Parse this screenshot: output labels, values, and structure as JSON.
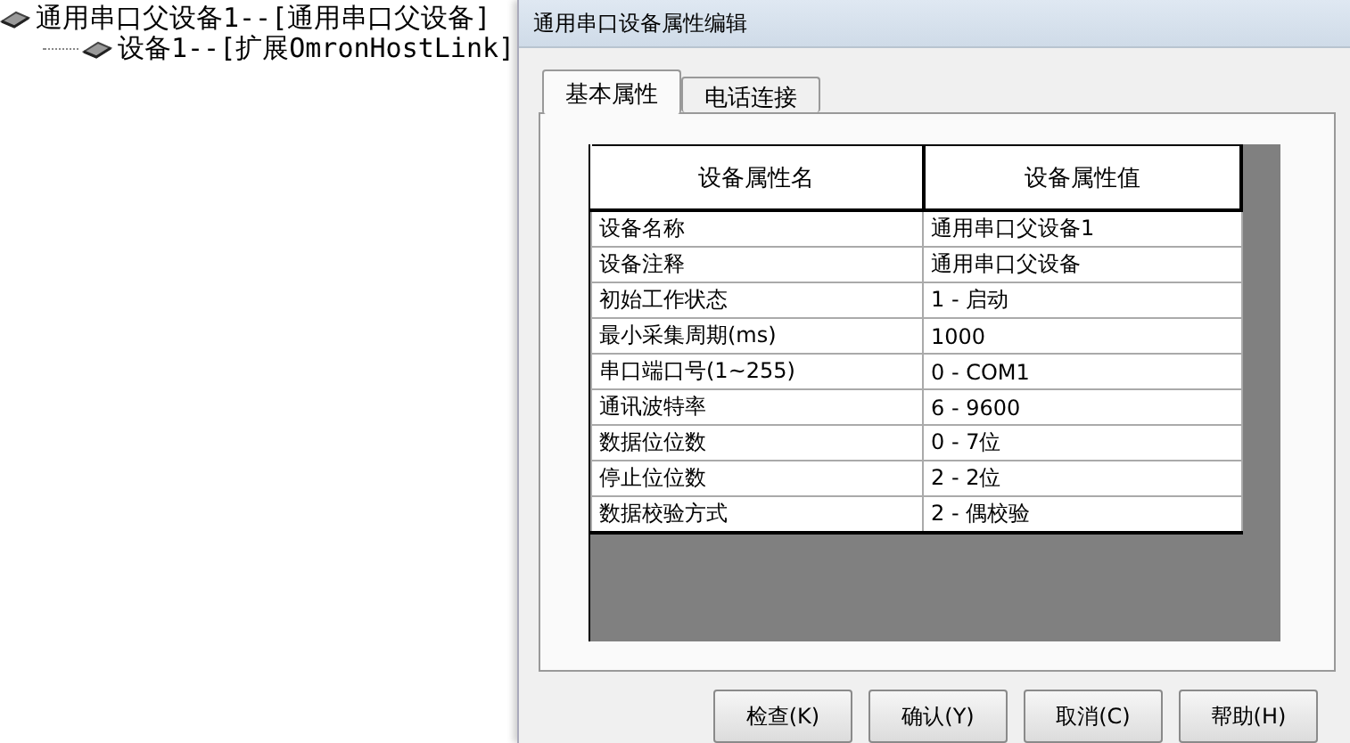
{
  "tree": [
    {
      "label": "通用串口父设备1--[通用串口父设备]",
      "children": [
        {
          "label": "设备1--[扩展OmronHostLink]"
        }
      ]
    }
  ],
  "dialog": {
    "title": "通用串口设备属性编辑",
    "tabs": [
      {
        "label": "基本属性",
        "selected": true
      },
      {
        "label": "电话连接",
        "selected": false
      }
    ],
    "table": {
      "columns": [
        "设备属性名",
        "设备属性值"
      ],
      "rows": [
        [
          "设备名称",
          "通用串口父设备1"
        ],
        [
          "设备注释",
          "通用串口父设备"
        ],
        [
          "初始工作状态",
          "1 - 启动"
        ],
        [
          "最小采集周期(ms)",
          "1000"
        ],
        [
          "串口端口号(1~255)",
          "0 - COM1"
        ],
        [
          "通讯波特率",
          "6 - 9600"
        ],
        [
          "数据位位数",
          "0 - 7位"
        ],
        [
          "停止位位数",
          "2 - 2位"
        ],
        [
          "数据校验方式",
          "2 - 偶校验"
        ]
      ]
    },
    "buttons": [
      "检查(K)",
      "确认(Y)",
      "取消(C)",
      "帮助(H)"
    ]
  }
}
